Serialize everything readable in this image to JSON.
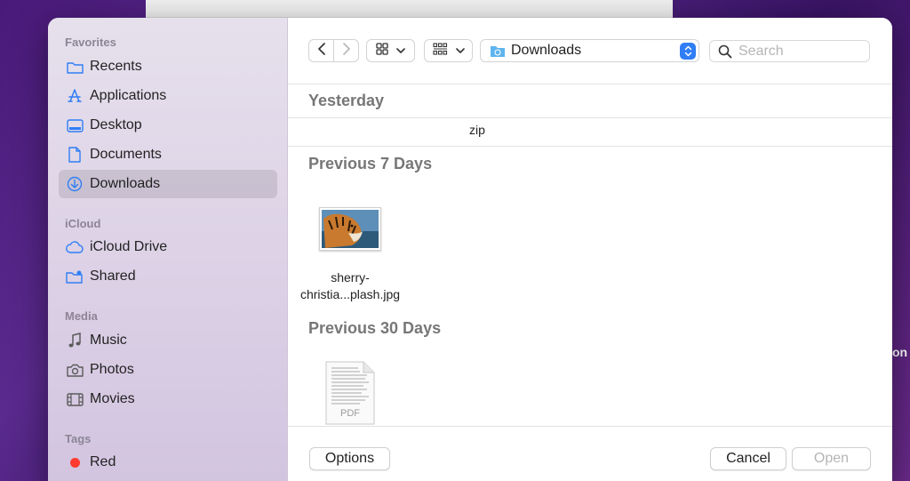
{
  "sidebar": {
    "sections": {
      "favorites": "Favorites",
      "icloud": "iCloud",
      "media": "Media",
      "tags": "Tags"
    },
    "favorites": [
      {
        "label": "Recents",
        "icon": "clock-folder-icon"
      },
      {
        "label": "Applications",
        "icon": "applications-icon"
      },
      {
        "label": "Desktop",
        "icon": "desktop-icon"
      },
      {
        "label": "Documents",
        "icon": "document-icon"
      },
      {
        "label": "Downloads",
        "icon": "download-icon",
        "selected": true
      }
    ],
    "icloud": [
      {
        "label": "iCloud Drive",
        "icon": "cloud-icon"
      },
      {
        "label": "Shared",
        "icon": "shared-folder-icon"
      }
    ],
    "media": [
      {
        "label": "Music",
        "icon": "music-note-icon"
      },
      {
        "label": "Photos",
        "icon": "camera-icon"
      },
      {
        "label": "Movies",
        "icon": "film-icon"
      }
    ],
    "tags": [
      {
        "label": "Red",
        "color": "#ff3b30"
      }
    ]
  },
  "toolbar": {
    "location": "Downloads",
    "search_placeholder": "Search"
  },
  "groups": [
    {
      "label": "Yesterday",
      "files": [
        {
          "name": "zip"
        }
      ]
    },
    {
      "label": "Previous 7 Days",
      "files": [
        {
          "name_line1": "sherry-",
          "name_line2": "christia...plash.jpg"
        }
      ]
    },
    {
      "label": "Previous 30 Days",
      "files": [
        {
          "type": "PDF"
        }
      ]
    }
  ],
  "footer": {
    "options": "Options",
    "cancel": "Cancel",
    "open": "Open"
  },
  "background": {
    "partial_text": "on"
  },
  "colors": {
    "accent": "#2f7ef6",
    "tag_red": "#ff3b30"
  }
}
